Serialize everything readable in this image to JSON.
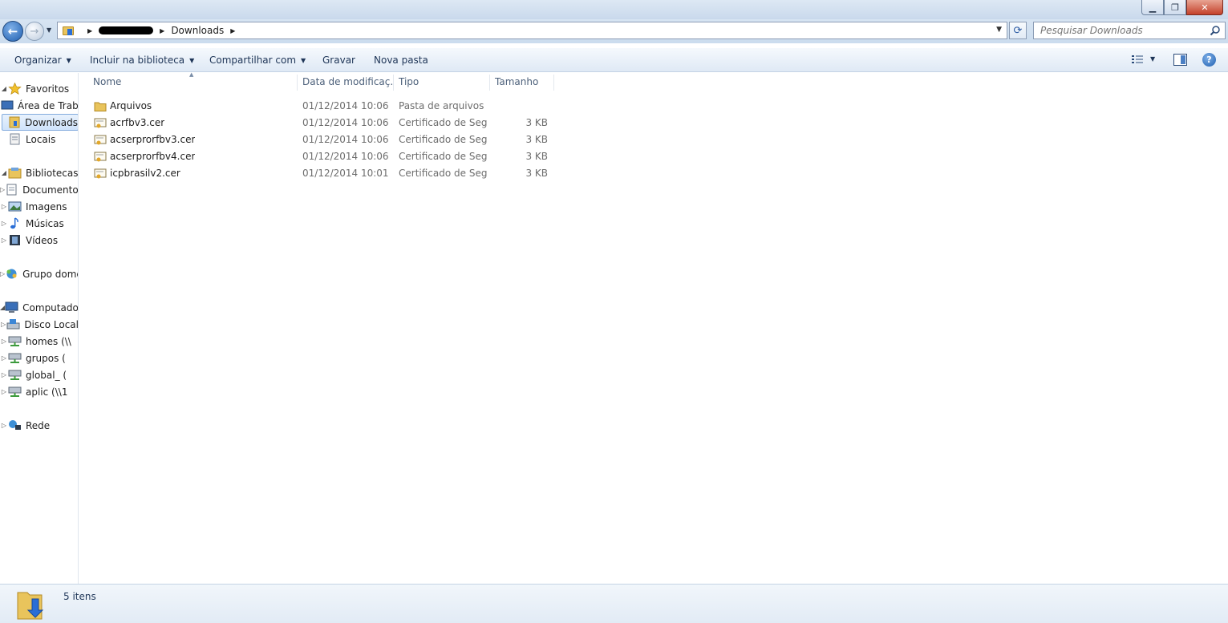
{
  "window": {
    "minimize_label": "▭",
    "restore_label": "❐",
    "close_label": "✕"
  },
  "address": {
    "current": "Downloads"
  },
  "search": {
    "placeholder": "Pesquisar Downloads"
  },
  "toolbar": {
    "organize": "Organizar",
    "include_library": "Incluir na biblioteca",
    "share_with": "Compartilhar com",
    "burn": "Gravar",
    "new_folder": "Nova pasta"
  },
  "nav": {
    "favorites": "Favoritos",
    "desktop": "Área de Trabalho",
    "downloads": "Downloads",
    "places": "Locais",
    "libraries": "Bibliotecas",
    "documents": "Documentos",
    "images": "Imagens",
    "music": "Músicas",
    "videos": "Vídeos",
    "homegroup": "Grupo doméstico",
    "computer": "Computador",
    "local_disk": "Disco Local",
    "homes": "homes (\\\\",
    "grupos": "grupos (",
    "global": "global_ (",
    "aplic": "aplic (\\\\1",
    "network": "Rede"
  },
  "columns": {
    "name": "Nome",
    "date": "Data de modificaç...",
    "type": "Tipo",
    "size": "Tamanho"
  },
  "files": [
    {
      "name": "Arquivos",
      "date": "01/12/2014 10:06",
      "type": "Pasta de arquivos",
      "size": "",
      "icon": "folder-icon"
    },
    {
      "name": "acrfbv3.cer",
      "date": "01/12/2014 10:06",
      "type": "Certificado de Seg...",
      "size": "3 KB",
      "icon": "certificate-icon"
    },
    {
      "name": "acserprorfbv3.cer",
      "date": "01/12/2014 10:06",
      "type": "Certificado de Seg...",
      "size": "3 KB",
      "icon": "certificate-icon"
    },
    {
      "name": "acserprorfbv4.cer",
      "date": "01/12/2014 10:06",
      "type": "Certificado de Seg...",
      "size": "3 KB",
      "icon": "certificate-icon"
    },
    {
      "name": "icpbrasilv2.cer",
      "date": "01/12/2014 10:01",
      "type": "Certificado de Seg...",
      "size": "3 KB",
      "icon": "certificate-icon"
    }
  ],
  "status": {
    "count": "5 itens"
  },
  "colors": {
    "accent": "#1f5fb0",
    "selection": "#cfe3fb",
    "folder": "#e9c45c"
  }
}
